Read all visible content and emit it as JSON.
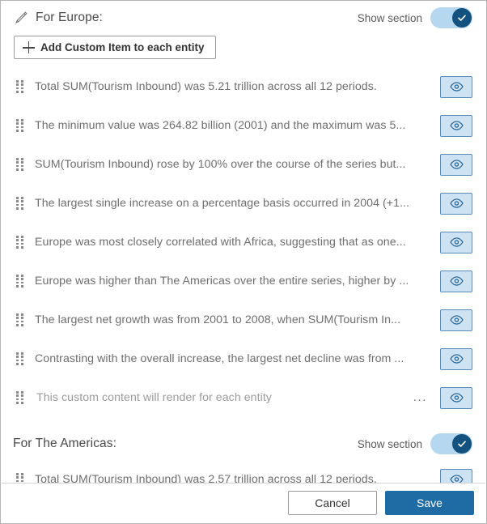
{
  "dialog": {
    "sections": [
      {
        "icon": "pencil-icon",
        "title": "For Europe:",
        "show_section_label": "Show section",
        "toggle_on": true,
        "add_button_label": "Add Custom Item to each entity",
        "items": [
          {
            "text": "Total SUM(Tourism Inbound) was 5.21 trillion across all 12 periods.",
            "visible": true,
            "has_menu": false
          },
          {
            "text": "The minimum value was 264.82 billion (2001) and the maximum was 5...",
            "visible": true,
            "has_menu": false
          },
          {
            "text": "SUM(Tourism Inbound) rose by 100% over the course of the series but...",
            "visible": true,
            "has_menu": false
          },
          {
            "text": "The largest single increase on a percentage basis occurred in 2004 (+1...",
            "visible": true,
            "has_menu": false
          },
          {
            "text": "Europe was most closely correlated with Africa, suggesting that as one...",
            "visible": true,
            "has_menu": false
          },
          {
            "text": "Europe was higher than The Americas over the entire series, higher by ...",
            "visible": true,
            "has_menu": false
          },
          {
            "text": "The largest net growth was from 2001 to 2008, when SUM(Tourism In...",
            "visible": true,
            "has_menu": false
          },
          {
            "text": "Contrasting with the overall increase, the largest net decline was from ...",
            "visible": true,
            "has_menu": false
          },
          {
            "text": "This custom content will render for each entity",
            "is_placeholder": true,
            "visible": true,
            "has_menu": true,
            "menu_label": "..."
          }
        ]
      },
      {
        "title": "For The Americas:",
        "show_section_label": "Show section",
        "toggle_on": true,
        "items": [
          {
            "text": "Total SUM(Tourism Inbound) was 2.57 trillion across all 12 periods.",
            "visible": true,
            "has_menu": false
          }
        ]
      }
    ],
    "footer": {
      "cancel_label": "Cancel",
      "save_label": "Save"
    },
    "colors": {
      "toggle_track": "#b5d8f0",
      "toggle_knob": "#13527f",
      "eye_button_fill": "#cde2f3",
      "eye_button_border": "#5a8bb8",
      "save_button": "#1f6ba4",
      "body_text": "#6e6e6e",
      "title_text": "#4a4a4a"
    }
  }
}
